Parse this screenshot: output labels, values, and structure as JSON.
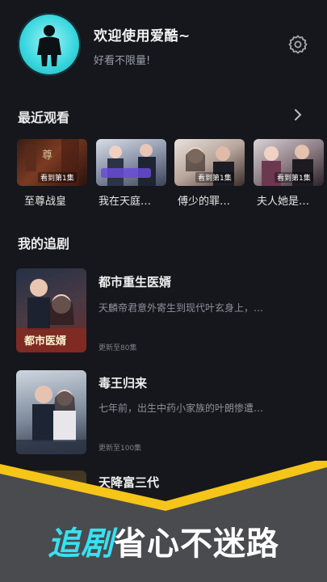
{
  "header": {
    "greeting": "欢迎使用爱酷~",
    "subtitle": "好看不限量!",
    "avatar_icon": "user-avatar-icon",
    "settings_icon": "gear-icon"
  },
  "recent": {
    "title": "最近观看",
    "items": [
      {
        "title": "至尊战皇",
        "tag": "看到第1集"
      },
      {
        "title": "我在天庭…",
        "tag": ""
      },
      {
        "title": "傅少的罪…",
        "tag": "看到第1集"
      },
      {
        "title": "夫人她是…",
        "tag": "看到第1集"
      }
    ]
  },
  "following": {
    "title": "我的追剧",
    "items": [
      {
        "title": "都市重生医婿",
        "desc": "天麟帝君意外寄生到现代叶玄身上，…",
        "update": "更新至80集"
      },
      {
        "title": "毒王归来",
        "desc": "七年前，出生中药小家族的叶朗惨遭…",
        "update": "更新至100集"
      },
      {
        "title": "天降富三代",
        "desc": "",
        "update": ""
      }
    ]
  },
  "banner": {
    "slogan_part1": "追剧",
    "slogan_part2": "省心不迷路"
  },
  "colors": {
    "background": "#15171c",
    "accent_cyan": "#39e0f0",
    "accent_yellow": "#f5c518"
  }
}
